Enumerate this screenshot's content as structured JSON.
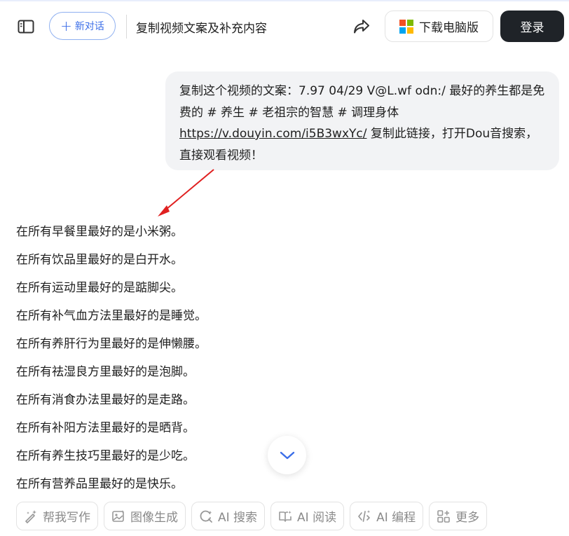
{
  "header": {
    "new_chat_label": "新对话",
    "conversation_title": "复制视频文案及补充内容",
    "download_label": "下载电脑版",
    "login_label": "登录",
    "windows_logo_colors": [
      "#f25022",
      "#7fba00",
      "#00a4ef",
      "#ffb900"
    ]
  },
  "user_message": {
    "prefix": "复制这个视频的文案：7.97 04/29 V@L.wf odn:/ 最好的养生都是免费的 # 养生 # 老祖宗的智慧 # 调理身体 ",
    "link": "https://v.douyin.com/i5B3wxYc/",
    "suffix": " 复制此链接，打开Dou音搜索，直接观看视频！"
  },
  "annotation": {
    "arrow_color": "#e02020"
  },
  "answer": {
    "lines": [
      "在所有早餐里最好的是小米粥。",
      "在所有饮品里最好的是白开水。",
      "在所有运动里最好的是踮脚尖。",
      "在所有补气血方法里最好的是睡觉。",
      "在所有养肝行为里最好的是伸懒腰。",
      "在所有祛湿良方里最好的是泡脚。",
      "在所有消食办法里最好的是走路。",
      "在所有补阳方法里最好的是晒背。",
      "在所有养生技巧里最好的是少吃。",
      "在所有营养品里最好的是快乐。"
    ]
  },
  "toolbar": {
    "items": [
      {
        "label": "帮我写作",
        "icon": "pen-sparkle-icon"
      },
      {
        "label": "图像生成",
        "icon": "image-icon"
      },
      {
        "label": "AI 搜索",
        "icon": "search-refresh-icon"
      },
      {
        "label": "AI 阅读",
        "icon": "book-icon"
      },
      {
        "label": "AI 编程",
        "icon": "code-icon"
      },
      {
        "label": "更多",
        "icon": "grid-icon"
      }
    ]
  }
}
